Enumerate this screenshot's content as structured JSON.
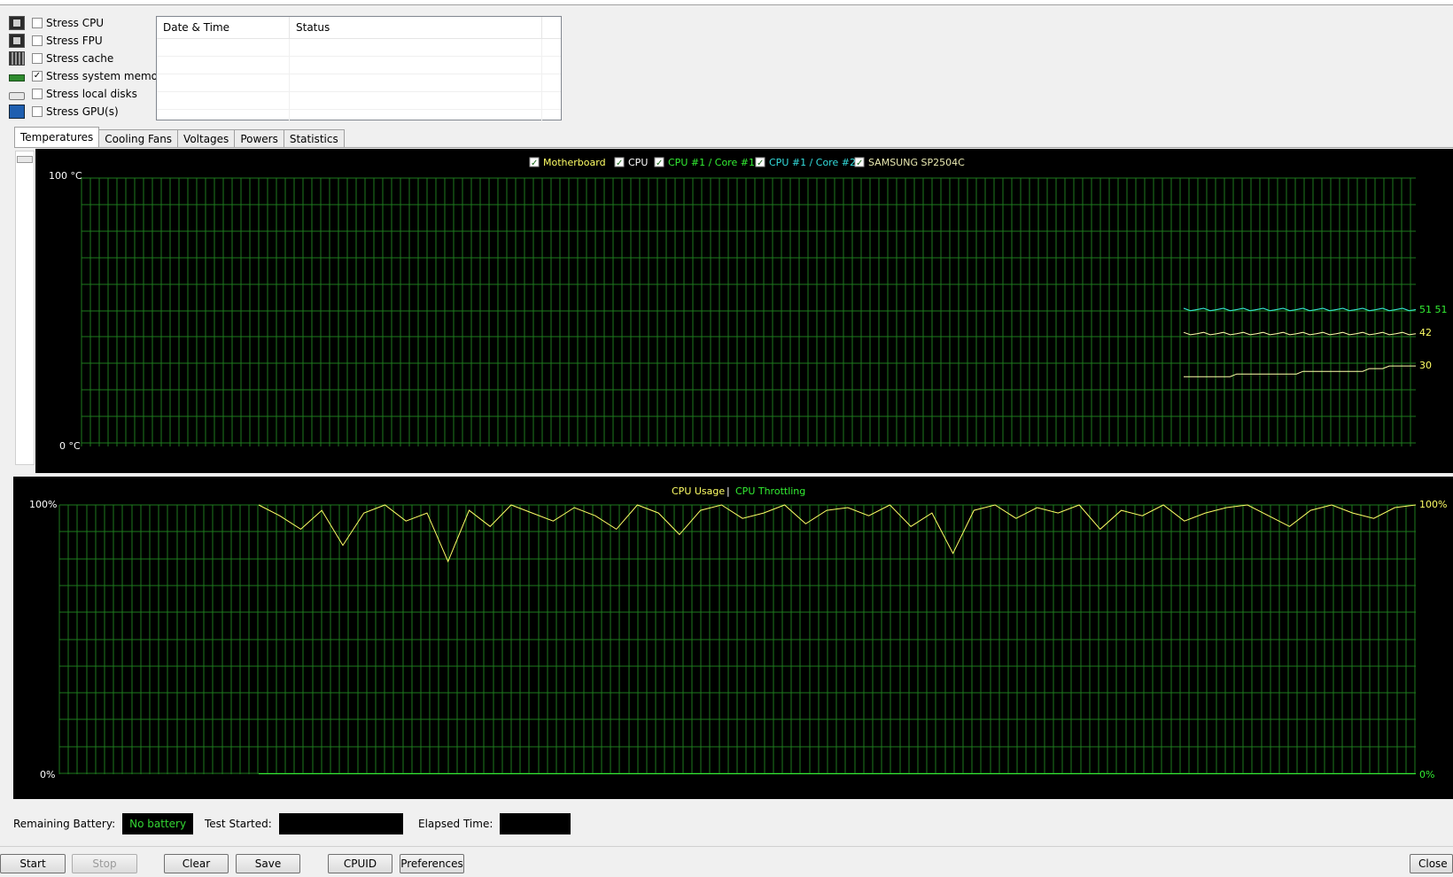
{
  "stress_options": [
    {
      "label": "Stress CPU",
      "checked": false,
      "icon": "cpu-chip-icon"
    },
    {
      "label": "Stress FPU",
      "checked": false,
      "icon": "fpu-chip-icon"
    },
    {
      "label": "Stress cache",
      "checked": false,
      "icon": "cache-chip-icon"
    },
    {
      "label": "Stress system memory",
      "checked": true,
      "icon": "memory-module-icon"
    },
    {
      "label": "Stress local disks",
      "checked": false,
      "icon": "hard-disk-icon"
    },
    {
      "label": "Stress GPU(s)",
      "checked": false,
      "icon": "gpu-monitor-icon"
    }
  ],
  "log": {
    "columns": [
      "Date & Time",
      "Status"
    ]
  },
  "tabs": [
    "Temperatures",
    "Cooling Fans",
    "Voltages",
    "Powers",
    "Statistics"
  ],
  "temperature_chart": {
    "legend": [
      {
        "label": "Motherboard",
        "color": "#ffff66",
        "checked": true
      },
      {
        "label": "CPU",
        "color": "#ffffff",
        "checked": true
      },
      {
        "label": "CPU #1 / Core #1",
        "color": "#33ee33",
        "checked": true
      },
      {
        "label": "CPU #1 / Core #2",
        "color": "#33dddd",
        "checked": true
      },
      {
        "label": "SAMSUNG SP2504C",
        "color": "#e8e8b0",
        "checked": true
      }
    ],
    "y_top_label": "100 °C",
    "y_bottom_label": "0 °C",
    "end_values": [
      "51 51",
      "42",
      "30"
    ]
  },
  "usage_chart": {
    "title_usage": "CPU Usage",
    "title_sep": "|",
    "title_throttle": "CPU Throttling",
    "y_top_label": "100%",
    "y_bottom_label": "0%",
    "right_top_label": "100%",
    "right_bottom_label": "0%"
  },
  "status": {
    "battery_label": "Remaining Battery:",
    "battery_value": "No battery",
    "started_label": "Test Started:",
    "started_value": "",
    "elapsed_label": "Elapsed Time:",
    "elapsed_value": ""
  },
  "buttons": {
    "start": "Start",
    "stop": "Stop",
    "clear": "Clear",
    "save": "Save",
    "cpuid": "CPUID",
    "preferences": "Preferences",
    "close": "Close"
  },
  "chart_data": [
    {
      "type": "line",
      "title": "",
      "ylabel": "°C",
      "ylim": [
        0,
        100
      ],
      "series": [
        {
          "name": "CPU #1 / Core #1",
          "values": [
            51,
            51,
            51,
            51,
            51,
            51,
            51,
            51,
            51,
            51,
            51,
            51,
            51,
            51,
            51,
            51,
            51,
            51,
            51,
            51,
            51,
            51,
            51,
            51,
            51,
            51,
            51,
            51,
            51,
            51,
            51,
            51,
            51,
            51,
            51,
            51
          ]
        },
        {
          "name": "CPU #1 / Core #2",
          "values": [
            51,
            51,
            51,
            51,
            51,
            51,
            51,
            51,
            51,
            51,
            51,
            51,
            51,
            51,
            51,
            51,
            51,
            51,
            51,
            51,
            51,
            51,
            51,
            51,
            51,
            51,
            51,
            51,
            51,
            51,
            51,
            51,
            51,
            51,
            51,
            51
          ]
        },
        {
          "name": "CPU",
          "values": [
            42,
            42,
            42,
            42,
            42,
            42,
            42,
            42,
            42,
            42,
            42,
            42,
            42,
            42,
            42,
            42,
            42,
            42,
            42,
            42,
            42,
            42,
            42,
            42,
            42,
            42,
            42,
            42,
            42,
            42,
            42,
            42,
            42,
            42,
            42,
            42
          ]
        },
        {
          "name": "Motherboard",
          "values": [
            26,
            26,
            26,
            26,
            26,
            26,
            26,
            26,
            27,
            27,
            27,
            27,
            27,
            27,
            27,
            27,
            27,
            27,
            28,
            28,
            28,
            28,
            28,
            28,
            28,
            28,
            28,
            28,
            29,
            29,
            29,
            30,
            30,
            30,
            30,
            30
          ]
        }
      ],
      "grid": true
    },
    {
      "type": "line",
      "title": "CPU Usage | CPU Throttling",
      "ylim": [
        0,
        100
      ],
      "series": [
        {
          "name": "CPU Usage",
          "values": [
            100,
            96,
            91,
            98,
            85,
            97,
            100,
            94,
            97,
            79,
            98,
            92,
            100,
            97,
            94,
            99,
            96,
            91,
            100,
            97,
            89,
            98,
            100,
            95,
            97,
            100,
            93,
            98,
            99,
            96,
            100,
            92,
            97,
            82,
            98,
            100,
            95,
            99,
            97,
            100,
            91,
            98,
            96,
            100,
            94,
            97,
            99,
            100,
            96,
            92,
            98,
            100,
            97,
            95,
            99,
            100
          ]
        },
        {
          "name": "CPU Throttling",
          "values": [
            0,
            0,
            0,
            0,
            0,
            0,
            0,
            0,
            0,
            0,
            0,
            0,
            0,
            0,
            0,
            0,
            0,
            0,
            0,
            0,
            0,
            0,
            0,
            0,
            0,
            0,
            0,
            0,
            0,
            0,
            0,
            0,
            0,
            0,
            0,
            0,
            0,
            0,
            0,
            0,
            0,
            0,
            0,
            0,
            0,
            0,
            0,
            0,
            0,
            0,
            0,
            0,
            0,
            0,
            0,
            0
          ]
        }
      ],
      "grid": true
    }
  ]
}
